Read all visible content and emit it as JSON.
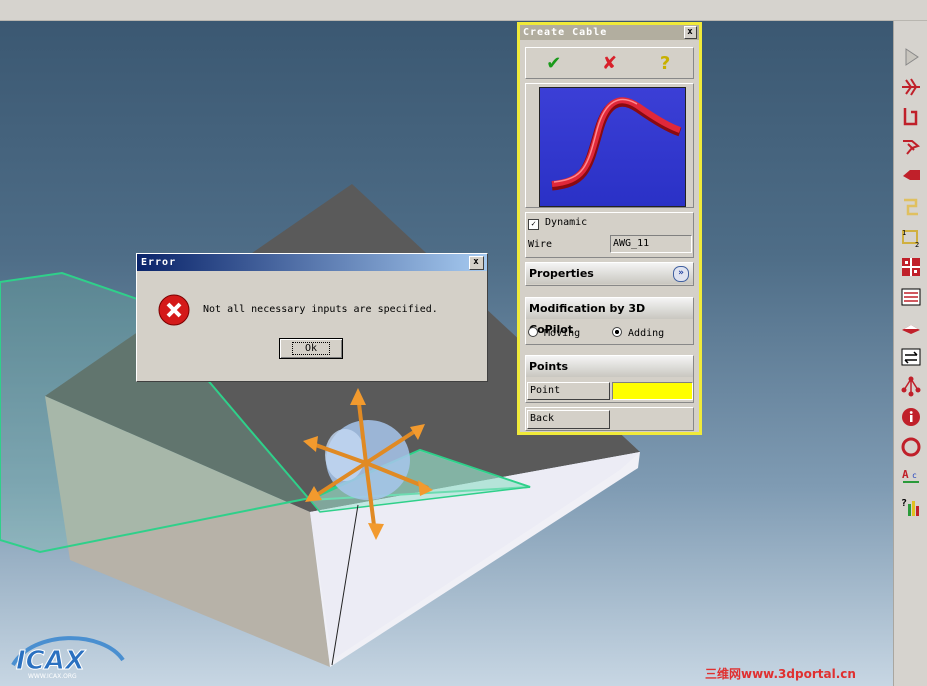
{
  "panel": {
    "title": "Create Cable",
    "close": "x",
    "dynamic_label": "Dynamic",
    "dynamic_checked": true,
    "wire_label": "Wire",
    "wire_value": "AWG_11",
    "properties_label": "Properties",
    "copilot_label": "Modification by 3D CoPilot",
    "moving_label": "Moving",
    "adding_label": "Adding",
    "selected_mode": "Adding",
    "points_label": "Points",
    "point_label": "Point",
    "point_color": "#ffff00",
    "back_label": "Back"
  },
  "dialog": {
    "title": "Error",
    "close": "x",
    "message": "Not all necessary inputs are specified.",
    "ok_label": "Ok"
  },
  "toolbar_icons": [
    "play-icon",
    "cable-branch-icon",
    "cable-route-icon",
    "connector-icon",
    "flag-icon",
    "bracket-icon",
    "numbering-icon",
    "grid-icon",
    "table-icon",
    "book-icon",
    "swap-icon",
    "network-icon",
    "info-icon",
    "ring-icon",
    "text-style-icon",
    "help-chart-icon"
  ],
  "logo_text": "ICAX",
  "logo_url": "WWW.ICAX.ORG",
  "watermark": "三维网www.3dportal.cn"
}
